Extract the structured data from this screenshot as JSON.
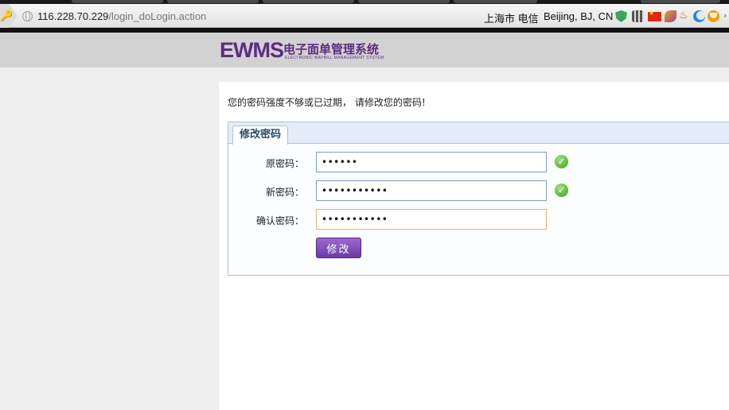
{
  "browser": {
    "url_host": "116.228.70.229",
    "url_path": "/login_doLogin.action",
    "location_isp": "上海市 电信",
    "location_geo": "Beijing, BJ, CN"
  },
  "header": {
    "logo_text": "EWMS",
    "logo_cn": "电子面单管理系统",
    "logo_en": "ELECTRONIC WAYBILL MANAGEMENT SYSTEM"
  },
  "main": {
    "notice": "您的密码强度不够或已过期， 请修改您的密码!",
    "panel_title": "修改密码",
    "fields": [
      {
        "label": "原密码：",
        "value": "••••••",
        "valid": true
      },
      {
        "label": "新密码：",
        "value": "•••••••••••",
        "valid": true
      },
      {
        "label": "确认密码：",
        "value": "•••••••••••",
        "valid": false
      }
    ],
    "submit_label": "修改"
  },
  "colors": {
    "brand_purple": "#5b2d82",
    "button_purple": "#7a48b8",
    "panel_border": "#a9c4db",
    "ok_green": "#4caf28"
  },
  "icons": [
    "key-icon",
    "globe-icon",
    "shield-icon",
    "qr-icon",
    "flag-icon",
    "check-icon"
  ]
}
